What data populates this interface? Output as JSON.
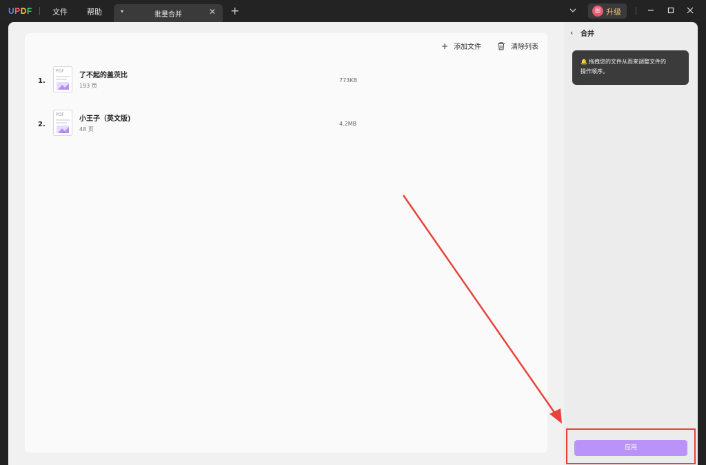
{
  "app": {
    "logo": [
      "U",
      "P",
      "D",
      "F"
    ],
    "menu": {
      "file": "文件",
      "help": "帮助"
    },
    "tab": {
      "title": "批量合并",
      "chevron": "▾",
      "close": "✕",
      "add": "+"
    },
    "upgrade": {
      "avatar": "图",
      "label": "升级"
    }
  },
  "toolbar": {
    "add_icon": "+",
    "add_label": "添加文件",
    "clear_label": "清除列表"
  },
  "files": [
    {
      "num": "1.",
      "name": "了不起的盖茨比",
      "pages": "193 页",
      "size": "773KB",
      "thumb_label": "PDF"
    },
    {
      "num": "2.",
      "name": "小王子（英文版)",
      "pages": "48 页",
      "size": "4.2MB",
      "thumb_label": "PDF"
    }
  ],
  "panel": {
    "back_icon": "‹",
    "title": "合并",
    "tooltip_line1": "拖拽您的文件从而来调整文件的",
    "tooltip_line2": "操作顺序。",
    "apply_label": "应用"
  },
  "colors": {
    "accent": "#bb92f7",
    "annotation": "#e8423a"
  }
}
